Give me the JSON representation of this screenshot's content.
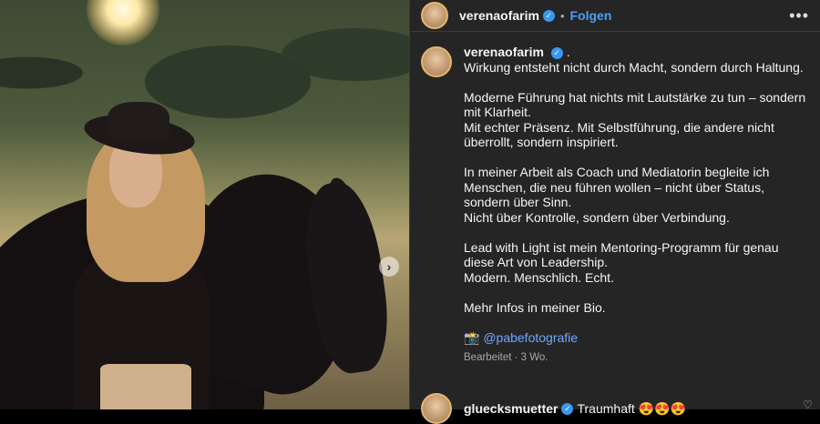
{
  "header": {
    "username": "verenaofarim",
    "separator": "•",
    "follow_label": "Folgen",
    "more_icon": "more-horizontal-icon"
  },
  "caption": {
    "username": "verenaofarim",
    "suffix": ".",
    "paragraphs": [
      [
        "Wirkung entsteht nicht durch Macht, sondern durch Haltung."
      ],
      [
        "Moderne Führung hat nichts mit Lautstärke zu tun – sondern mit Klarheit.",
        "Mit echter Präsenz. Mit Selbstführung, die andere nicht überrollt, sondern inspiriert."
      ],
      [
        "In meiner Arbeit als Coach und Mediatorin begleite ich Menschen, die neu führen wollen – nicht über Status, sondern über Sinn.",
        "Nicht über Kontrolle, sondern über Verbindung."
      ],
      [
        "Lead with Light ist mein Mentoring-Programm für genau diese Art von Leadership.",
        "Modern. Menschlich. Echt."
      ],
      [
        "Mehr Infos in meiner Bio."
      ]
    ],
    "credit_emoji": "📸",
    "credit_mention": "@pabefotografie",
    "meta": "Bearbeitet · 3 Wo."
  },
  "comment": {
    "username": "gluecksmuetter",
    "text": "Traumhaft 😍😍😍"
  },
  "carousel": {
    "next_icon": "chevron-right-icon"
  }
}
